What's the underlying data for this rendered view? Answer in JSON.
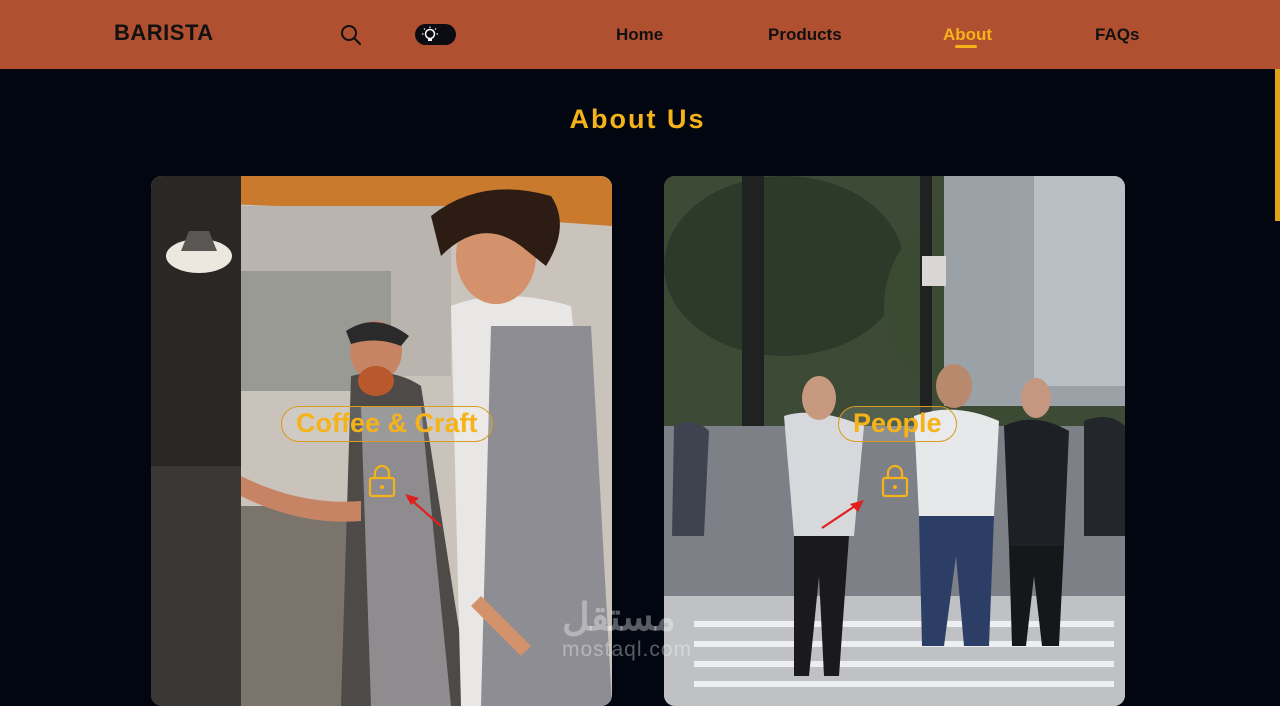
{
  "nav": {
    "brand": "BARISTA",
    "search_icon": "search-icon",
    "theme_icon": "lightbulb-icon",
    "links": [
      "Home",
      "Products",
      "About",
      "FAQs"
    ],
    "active_link": "About",
    "background": "#b05030",
    "accent": "#f6b319"
  },
  "page": {
    "title": "About Us",
    "background": "#020611"
  },
  "cards": [
    {
      "label": "Coffee & Craft",
      "icon": "lock-icon",
      "pointer_icon": "red-arrow-icon"
    },
    {
      "label": "People",
      "icon": "lock-icon",
      "pointer_icon": "red-arrow-icon"
    }
  ],
  "watermark": {
    "arabic": "مستقل",
    "latin": "mostaql.com"
  }
}
